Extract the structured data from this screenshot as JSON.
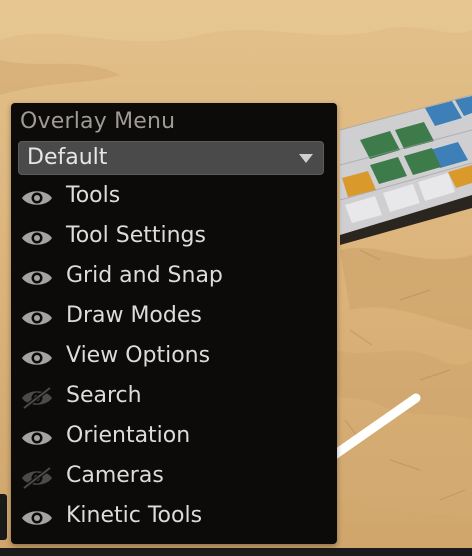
{
  "overlay_menu": {
    "title": "Overlay Menu",
    "preset": {
      "selected": "Default"
    },
    "items": [
      {
        "label": "Tools",
        "visible": true,
        "icon": "eye-icon"
      },
      {
        "label": "Tool Settings",
        "visible": true,
        "icon": "eye-icon"
      },
      {
        "label": "Grid and Snap",
        "visible": true,
        "icon": "eye-icon"
      },
      {
        "label": "Draw Modes",
        "visible": true,
        "icon": "eye-icon"
      },
      {
        "label": "View Options",
        "visible": true,
        "icon": "eye-icon"
      },
      {
        "label": "Search",
        "visible": false,
        "icon": "eye-off-icon"
      },
      {
        "label": "Orientation",
        "visible": true,
        "icon": "eye-icon"
      },
      {
        "label": "Cameras",
        "visible": false,
        "icon": "eye-off-icon"
      },
      {
        "label": "Kinetic Tools",
        "visible": true,
        "icon": "eye-icon"
      }
    ]
  },
  "annotation": {
    "icon": "arrow-pointer-icon",
    "color": "#ffffff"
  },
  "colors": {
    "panel_background": "#0d0b09",
    "dropdown_background": "#4a4a4a",
    "sand": "#dcb57e",
    "tile_blue": "#3e7fb8",
    "tile_green": "#3d7b4a",
    "tile_orange": "#d99a2b"
  }
}
